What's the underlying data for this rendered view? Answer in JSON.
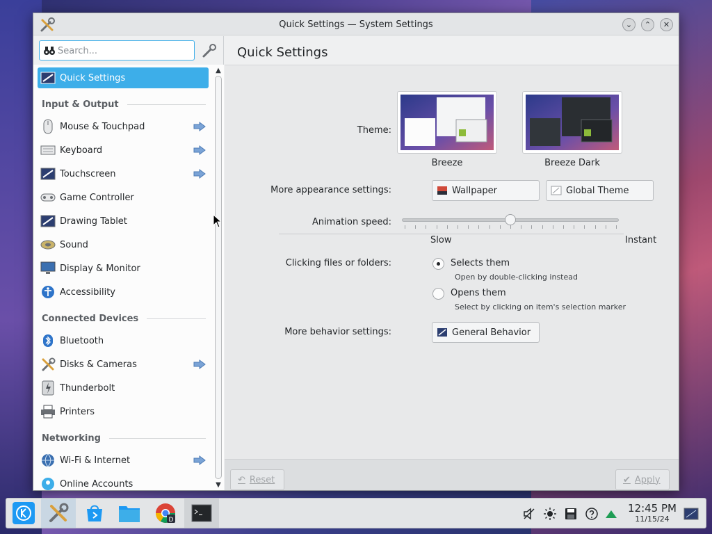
{
  "window": {
    "title": "Quick Settings — System Settings",
    "controls": [
      "minimize",
      "maximize",
      "close"
    ]
  },
  "sidebar": {
    "search_placeholder": "Search...",
    "items": [
      {
        "label": "Quick Settings",
        "icon": "quick-settings-icon",
        "active": true,
        "has_arrow": false
      },
      {
        "header": "Input & Output"
      },
      {
        "label": "Mouse & Touchpad",
        "icon": "mouse-icon",
        "has_arrow": true
      },
      {
        "label": "Keyboard",
        "icon": "keyboard-icon",
        "has_arrow": true
      },
      {
        "label": "Touchscreen",
        "icon": "touchscreen-icon",
        "has_arrow": true
      },
      {
        "label": "Game Controller",
        "icon": "gamepad-icon",
        "has_arrow": false
      },
      {
        "label": "Drawing Tablet",
        "icon": "tablet-icon",
        "has_arrow": false
      },
      {
        "label": "Sound",
        "icon": "speaker-icon",
        "has_arrow": false
      },
      {
        "label": "Display & Monitor",
        "icon": "monitor-icon",
        "has_arrow": false
      },
      {
        "label": "Accessibility",
        "icon": "accessibility-icon",
        "has_arrow": false
      },
      {
        "header": "Connected Devices"
      },
      {
        "label": "Bluetooth",
        "icon": "bluetooth-icon",
        "has_arrow": false
      },
      {
        "label": "Disks & Cameras",
        "icon": "tools-icon",
        "has_arrow": true
      },
      {
        "label": "Thunderbolt",
        "icon": "thunderbolt-icon",
        "has_arrow": false
      },
      {
        "label": "Printers",
        "icon": "printer-icon",
        "has_arrow": false
      },
      {
        "header": "Networking"
      },
      {
        "label": "Wi-Fi & Internet",
        "icon": "globe-icon",
        "has_arrow": true
      },
      {
        "label": "Online Accounts",
        "icon": "accounts-icon",
        "has_arrow": false
      }
    ]
  },
  "main": {
    "title": "Quick Settings",
    "theme": {
      "label": "Theme:",
      "options": [
        {
          "name": "Breeze",
          "variant": "light"
        },
        {
          "name": "Breeze Dark",
          "variant": "dark"
        }
      ]
    },
    "appearance": {
      "label": "More appearance settings:",
      "buttons": [
        "Wallpaper",
        "Global Theme"
      ]
    },
    "animation": {
      "label": "Animation speed:",
      "min_label": "Slow",
      "max_label": "Instant",
      "value_fraction": 0.5
    },
    "clicking": {
      "label": "Clicking files or folders:",
      "options": [
        {
          "label": "Selects them",
          "hint": "Open by double-clicking instead",
          "checked": true
        },
        {
          "label": "Opens them",
          "hint": "Select by clicking on item's selection marker",
          "checked": false
        }
      ]
    },
    "behavior": {
      "label": "More behavior settings:",
      "button": "General Behavior"
    },
    "footer": {
      "reset": "Reset",
      "apply": "Apply"
    }
  },
  "taskbar": {
    "time": "12:45 PM",
    "date": "11/15/24"
  },
  "colors": {
    "accent": "#3daee9",
    "window_bg": "#eff0f1"
  }
}
